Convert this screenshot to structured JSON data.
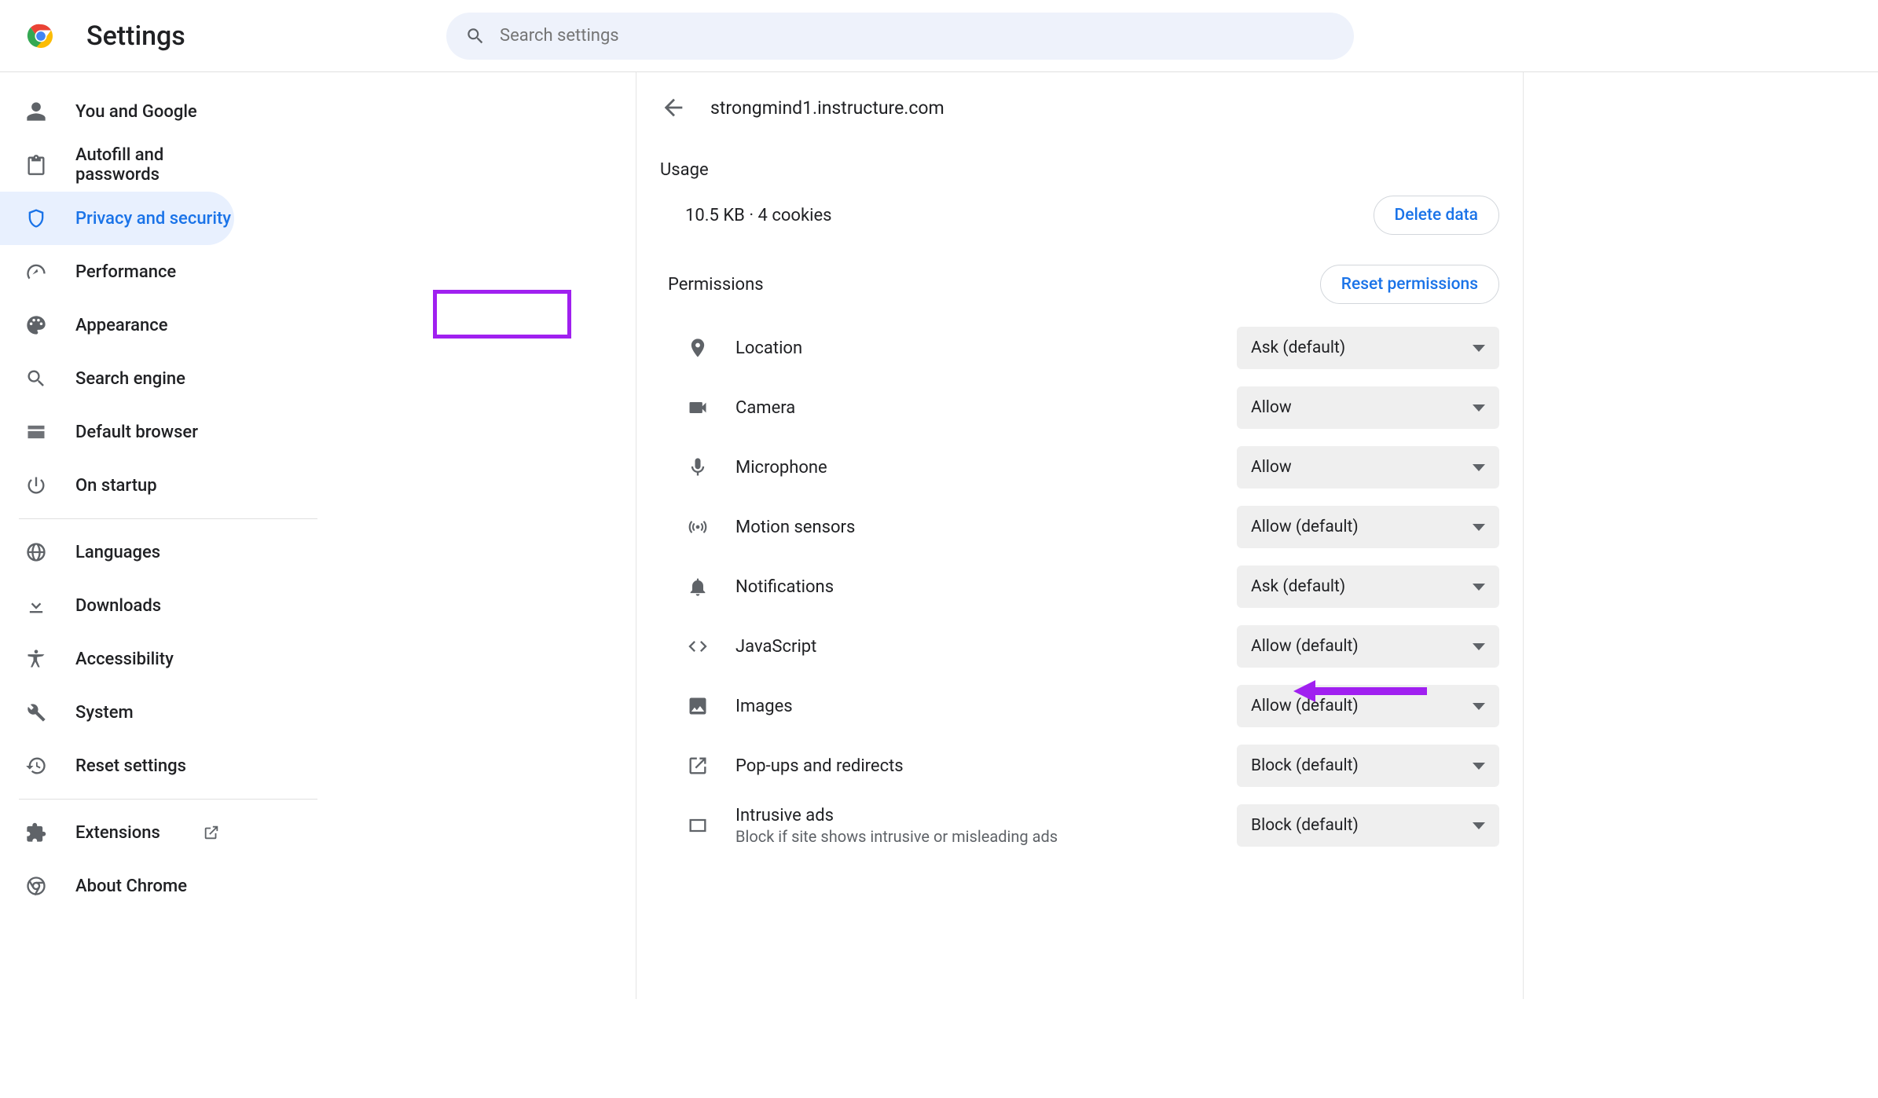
{
  "app_title": "Settings",
  "search": {
    "placeholder": "Search settings"
  },
  "sidebar": {
    "groups": [
      [
        {
          "key": "you",
          "label": "You and Google"
        },
        {
          "key": "autofill",
          "label": "Autofill and passwords"
        },
        {
          "key": "privacy",
          "label": "Privacy and security",
          "active": true
        },
        {
          "key": "performance",
          "label": "Performance"
        },
        {
          "key": "appearance",
          "label": "Appearance"
        },
        {
          "key": "search",
          "label": "Search engine"
        },
        {
          "key": "default",
          "label": "Default browser"
        },
        {
          "key": "startup",
          "label": "On startup"
        }
      ],
      [
        {
          "key": "languages",
          "label": "Languages"
        },
        {
          "key": "downloads",
          "label": "Downloads"
        },
        {
          "key": "accessibility",
          "label": "Accessibility"
        },
        {
          "key": "system",
          "label": "System"
        },
        {
          "key": "reset",
          "label": "Reset settings"
        }
      ],
      [
        {
          "key": "extensions",
          "label": "Extensions",
          "external": true
        },
        {
          "key": "about",
          "label": "About Chrome"
        }
      ]
    ]
  },
  "site": {
    "host": "strongmind1.instructure.com"
  },
  "usage": {
    "section_label": "Usage",
    "summary": "10.5 KB · 4 cookies",
    "delete_label": "Delete data"
  },
  "permissions": {
    "section_label": "Permissions",
    "reset_label": "Reset permissions",
    "rows": [
      {
        "key": "location",
        "label": "Location",
        "value": "Ask (default)"
      },
      {
        "key": "camera",
        "label": "Camera",
        "value": "Allow"
      },
      {
        "key": "microphone",
        "label": "Microphone",
        "value": "Allow"
      },
      {
        "key": "motion",
        "label": "Motion sensors",
        "value": "Allow (default)"
      },
      {
        "key": "notifications",
        "label": "Notifications",
        "value": "Ask (default)"
      },
      {
        "key": "javascript",
        "label": "JavaScript",
        "value": "Allow (default)"
      },
      {
        "key": "images",
        "label": "Images",
        "value": "Allow (default)"
      },
      {
        "key": "popups",
        "label": "Pop-ups and redirects",
        "value": "Block (default)"
      },
      {
        "key": "intrusive",
        "label": "Intrusive ads",
        "sub": "Block if site shows intrusive or misleading ads",
        "value": "Block (default)"
      }
    ]
  },
  "annotations": {
    "highlight_target": "permissions_label",
    "arrow_target": "javascript_select",
    "arrow_color": "#a020f0"
  }
}
